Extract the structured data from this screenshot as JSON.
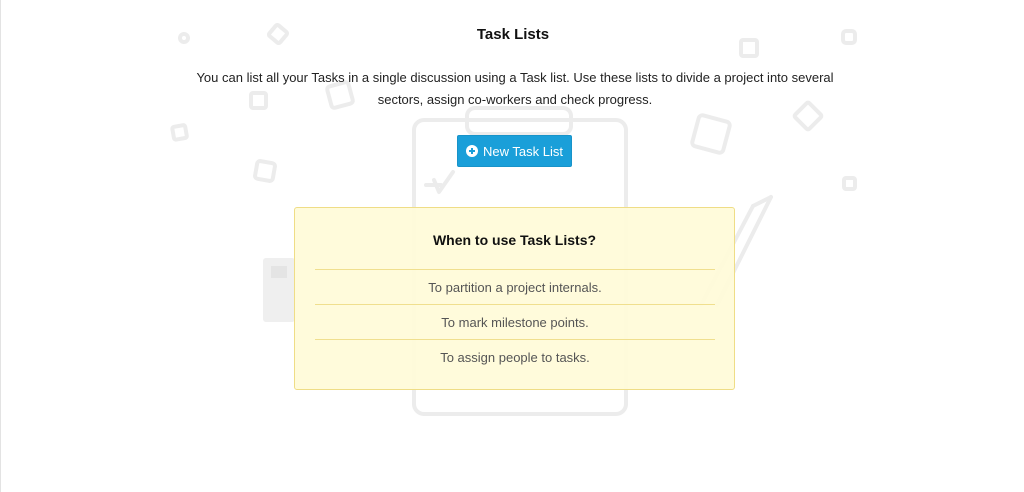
{
  "page": {
    "title": "Task Lists",
    "description": "You can list all your Tasks in a single discussion using a Task list. Use these lists to divide a project into several sectors, assign co-workers and check progress."
  },
  "new_button": {
    "label": "New Task List",
    "icon": "plus-circle-icon",
    "color": "#1a9fd9"
  },
  "info_box": {
    "title": "When to use Task Lists?",
    "items": [
      "To partition a project internals.",
      "To mark milestone points.",
      "To assign people to tasks."
    ],
    "background": "#fffbd8",
    "border": "#efdd86"
  }
}
